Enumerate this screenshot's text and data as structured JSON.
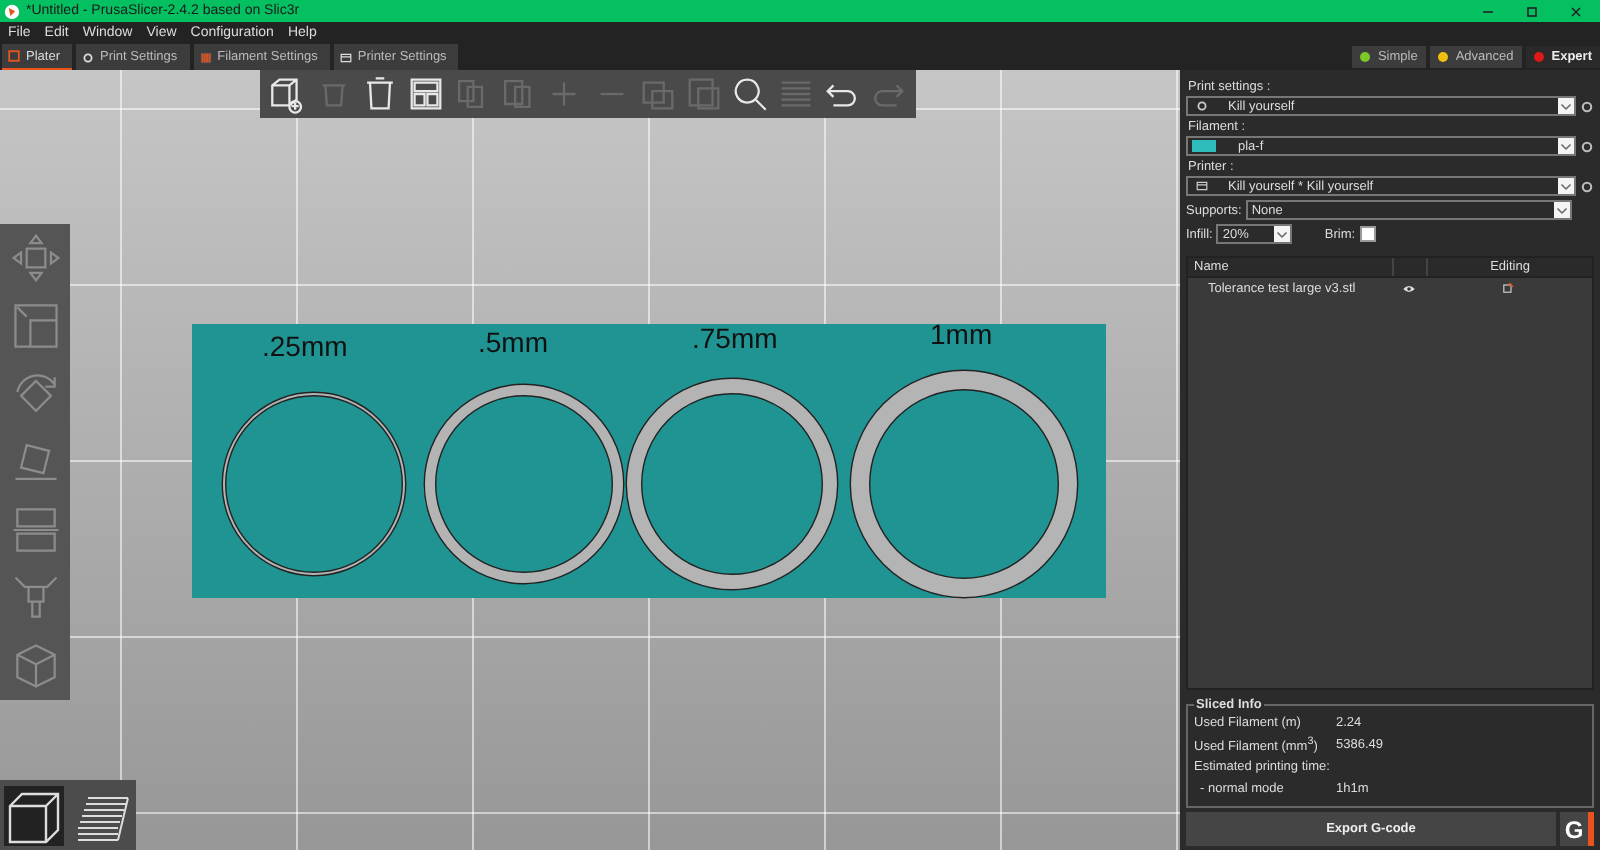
{
  "window": {
    "title": "*Untitled - PrusaSlicer-2.4.2 based on Slic3r"
  },
  "menu": [
    "File",
    "Edit",
    "Window",
    "View",
    "Configuration",
    "Help"
  ],
  "tabs": [
    {
      "label": "Plater",
      "kind": "plater",
      "selected": true
    },
    {
      "label": "Print Settings",
      "kind": "print",
      "selected": false
    },
    {
      "label": "Filament Settings",
      "kind": "filament",
      "selected": false
    },
    {
      "label": "Printer Settings",
      "kind": "printer",
      "selected": false
    }
  ],
  "modes": [
    {
      "label": "Simple",
      "color": "#7ec82a",
      "selected": false
    },
    {
      "label": "Advanced",
      "color": "#f0c010",
      "selected": false
    },
    {
      "label": "Expert",
      "color": "#e01818",
      "selected": true
    }
  ],
  "toolbar": [
    {
      "kind": "add",
      "disabled": false
    },
    {
      "kind": "delete",
      "disabled": true
    },
    {
      "kind": "delete_all",
      "disabled": false
    },
    {
      "kind": "arrange",
      "disabled": false
    },
    {
      "kind": "copy",
      "disabled": true
    },
    {
      "kind": "paste",
      "disabled": true
    },
    {
      "kind": "increase",
      "disabled": true
    },
    {
      "kind": "decrease",
      "disabled": true
    },
    {
      "kind": "split_objects",
      "disabled": true
    },
    {
      "kind": "split_parts",
      "disabled": true
    },
    {
      "kind": "search",
      "disabled": false
    },
    {
      "kind": "layers",
      "disabled": true
    },
    {
      "kind": "undo",
      "disabled": false
    },
    {
      "kind": "redo",
      "disabled": true
    }
  ],
  "gizmos": [
    {
      "kind": "move"
    },
    {
      "kind": "scale"
    },
    {
      "kind": "rotate"
    },
    {
      "kind": "place"
    },
    {
      "kind": "cut"
    },
    {
      "kind": "supports"
    },
    {
      "kind": "measure"
    }
  ],
  "views": [
    {
      "kind": "perspective",
      "selected": true
    },
    {
      "kind": "preview",
      "selected": false
    }
  ],
  "models": [
    {
      "label": ".25mm"
    },
    {
      "label": ".5mm"
    },
    {
      "label": ".75mm"
    },
    {
      "label": "1mm"
    }
  ],
  "sidebar": {
    "print_settings": {
      "label": "Print settings :",
      "value": "Kill yourself"
    },
    "filament": {
      "label": "Filament :",
      "value": "pla-f",
      "color": "#2fbcbc"
    },
    "printer": {
      "label": "Printer :",
      "value": "Kill yourself * Kill yourself"
    },
    "supports": {
      "label": "Supports:",
      "value": "None"
    },
    "infill": {
      "label": "Infill:",
      "value": "20%"
    },
    "brim": {
      "label": "Brim:",
      "checked": false
    },
    "objects": {
      "columns": [
        "Name",
        "",
        "Editing"
      ],
      "rows": [
        {
          "name": "Tolerance test large v3.stl"
        }
      ]
    },
    "sliced_info": {
      "title": "Sliced Info",
      "rows": [
        {
          "label": "Used Filament (m)",
          "value": "2.24"
        },
        {
          "label": "Used Filament (mm$^{3}$)",
          "value": "5386.49"
        }
      ],
      "time_label": "Estimated printing time:",
      "mode_label": "- normal mode",
      "mode_value": "1h1m"
    },
    "export": {
      "label": "Export G-code",
      "send_label": "G"
    }
  }
}
